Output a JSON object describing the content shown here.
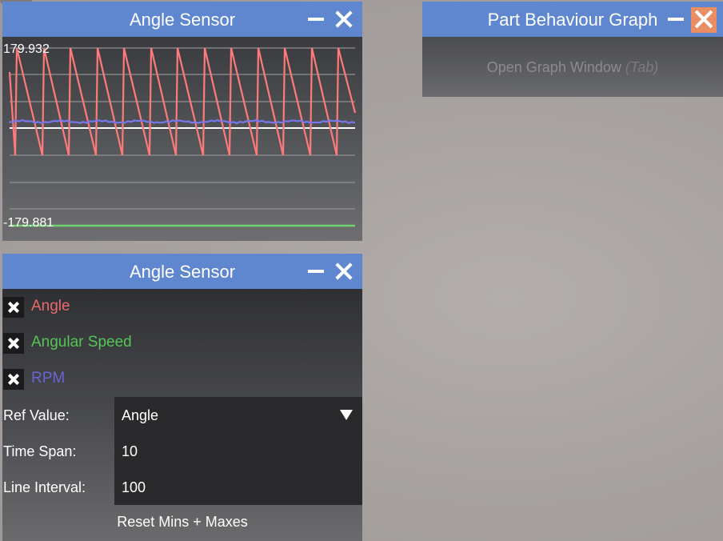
{
  "graph_window": {
    "title": "Angle Sensor",
    "max_label": "179.932",
    "min_label": "-179.881"
  },
  "settings_window": {
    "title": "Angle Sensor",
    "checkboxes": [
      {
        "label": "Angle",
        "checked": true,
        "color": "#e86a6a"
      },
      {
        "label": "Angular Speed",
        "checked": true,
        "color": "#56c456"
      },
      {
        "label": "RPM",
        "checked": true,
        "color": "#6a64d6"
      }
    ],
    "fields": {
      "ref_value_label": "Ref Value:",
      "ref_value": "Angle",
      "time_span_label": "Time Span:",
      "time_span": "10",
      "line_interval_label": "Line Interval:",
      "line_interval": "100"
    },
    "reset_button": "Reset Mins + Maxes"
  },
  "part_behaviour_window": {
    "title": "Part Behaviour Graph",
    "open_graph_label": "Open Graph Window",
    "open_graph_hint": "(Tab)"
  },
  "chart_data": {
    "type": "line",
    "ylim": [
      -179.881,
      179.932
    ],
    "series": [
      {
        "name": "Angle",
        "color": "#ff7a7a",
        "pattern": "sawtooth",
        "cycles": 13
      },
      {
        "name": "Angular Speed",
        "color": "#6fd36f",
        "pattern": "constant"
      },
      {
        "name": "RPM",
        "color": "#7777ee",
        "pattern": "constant-noisy"
      }
    ]
  },
  "colors": {
    "titlebar": "#5f87d0",
    "close_active": "#e98e63"
  },
  "icons": {
    "minimize": "minus-icon",
    "close": "x-icon",
    "dropdown": "triangle-down-icon",
    "check": "x-check-icon"
  }
}
